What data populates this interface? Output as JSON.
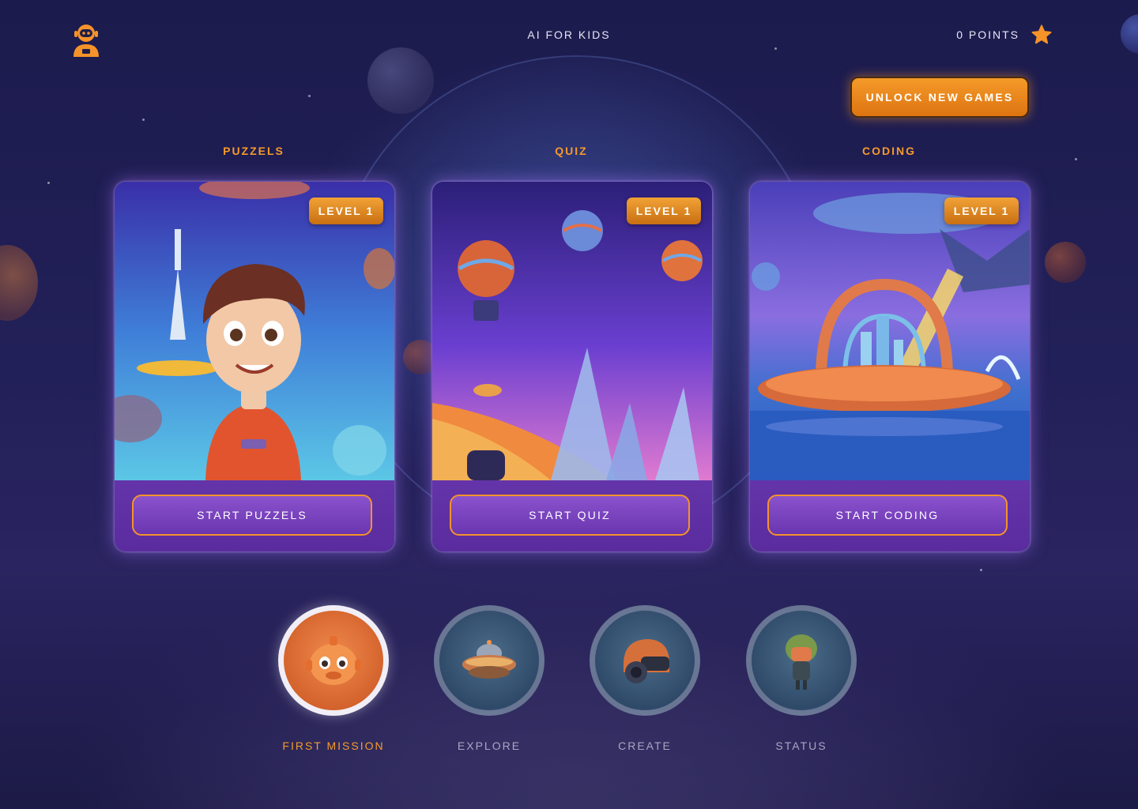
{
  "header": {
    "title": "AI FOR KIDS",
    "points_label": "0 POINTS",
    "logo_icon": "astronaut-icon",
    "points_icon": "star-icon"
  },
  "unlock_button": "UNLOCK NEW GAMES",
  "colors": {
    "accent": "#f59a2a",
    "card": "#7c46c0",
    "background": "#1f1d50"
  },
  "categories": [
    {
      "label": "PUZZELS",
      "level": "LEVEL 1",
      "button": "START PUZZELS",
      "art_icon": "astronaut-boy-illustration"
    },
    {
      "label": "QUIZ",
      "level": "LEVEL 1",
      "button": "START QUIZ",
      "art_icon": "balloon-planet-illustration"
    },
    {
      "label": "CODING",
      "level": "LEVEL 1",
      "button": "START CODING",
      "art_icon": "space-city-illustration"
    }
  ],
  "nav": [
    {
      "label": "FIRST MISSION",
      "icon": "robot-pig-icon",
      "active": true
    },
    {
      "label": "EXPLORE",
      "icon": "ufo-icon",
      "active": false
    },
    {
      "label": "CREATE",
      "icon": "helmet-icon",
      "active": false
    },
    {
      "label": "STATUS",
      "icon": "alien-astronaut-icon",
      "active": false
    }
  ]
}
